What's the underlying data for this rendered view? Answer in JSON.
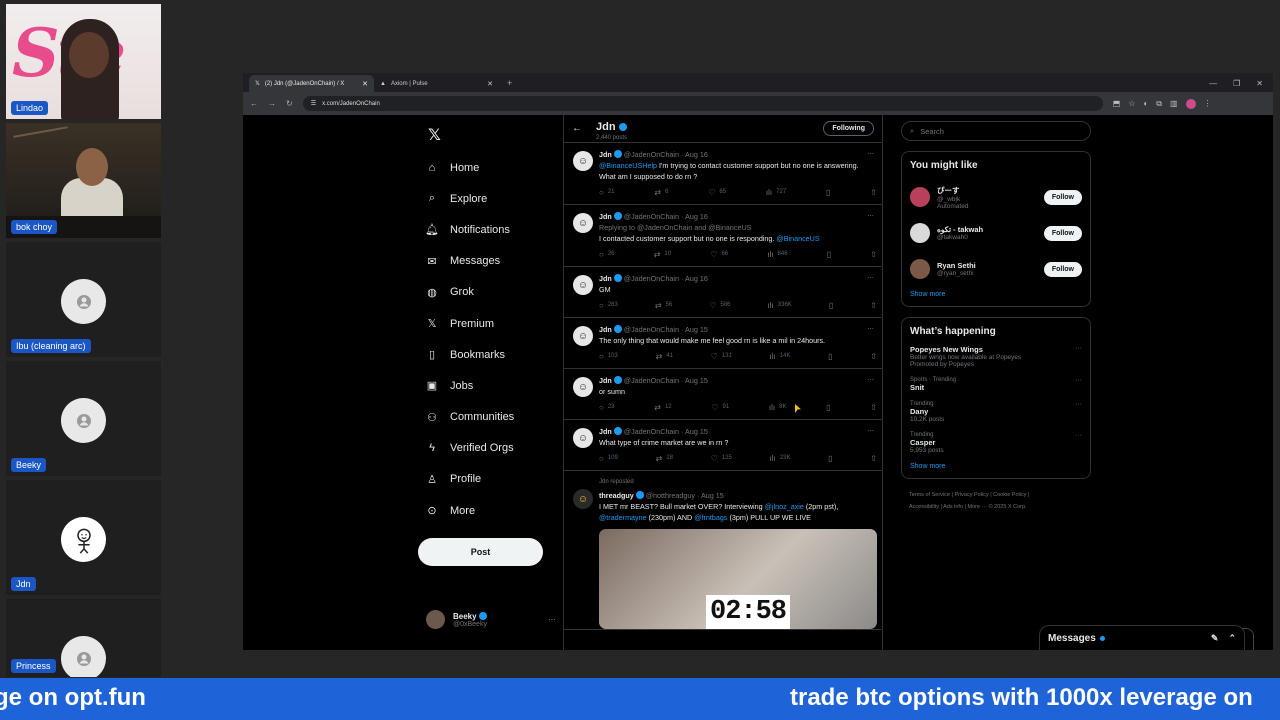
{
  "participants": [
    {
      "name": "Lindao",
      "video": true
    },
    {
      "name": "bok choy",
      "video": true
    },
    {
      "name": "Ibu (cleaning arc)",
      "video": false
    },
    {
      "name": "Beeky",
      "video": false
    },
    {
      "name": "Jdn",
      "video": false
    },
    {
      "name": "Princess",
      "video": false
    }
  ],
  "video_overlay_text": "Ste",
  "browser": {
    "tabs": [
      {
        "title": "(2) Jdn (@JadenOnChain) / X",
        "icon": "x-icon"
      },
      {
        "title": "Axiom | Pulse",
        "icon": "axiom-icon"
      }
    ],
    "url": "x.com/JadenOnChain"
  },
  "nav": {
    "items": [
      {
        "label": "Home",
        "icon": "home-icon"
      },
      {
        "label": "Explore",
        "icon": "search-icon"
      },
      {
        "label": "Notifications",
        "icon": "bell-icon"
      },
      {
        "label": "Messages",
        "icon": "mail-icon"
      },
      {
        "label": "Grok",
        "icon": "grok-icon"
      },
      {
        "label": "Premium",
        "icon": "x-icon"
      },
      {
        "label": "Bookmarks",
        "icon": "bookmark-icon"
      },
      {
        "label": "Jobs",
        "icon": "briefcase-icon"
      },
      {
        "label": "Communities",
        "icon": "people-icon"
      },
      {
        "label": "Verified Orgs",
        "icon": "lightning-icon"
      },
      {
        "label": "Profile",
        "icon": "person-icon"
      },
      {
        "label": "More",
        "icon": "more-circle-icon"
      }
    ],
    "post_label": "Post",
    "account": {
      "name": "Beeky",
      "handle": "@0xBeeky"
    }
  },
  "profile_header": {
    "name": "Jdn",
    "posts": "2,440 posts",
    "following_label": "Following"
  },
  "tweets": [
    {
      "name": "Jdn",
      "handle": "@JadenOnChain",
      "date": "Aug 16",
      "reply_to": "",
      "mention": "@BinanceUSHelp",
      "text": "I'm trying to contact customer support but no one is answering. What am I supposed to do rn ?",
      "tail": "",
      "replies": "21",
      "reposts": "6",
      "likes": "65",
      "views": "727"
    },
    {
      "name": "Jdn",
      "handle": "@JadenOnChain",
      "date": "Aug 16",
      "reply_to": "Replying to @JadenOnChain and @BinanceUS",
      "mention": "",
      "text": "I contacted customer support but no one is responding.",
      "tail": "@BinanceUS",
      "replies": "26",
      "reposts": "10",
      "likes": "66",
      "views": "846"
    },
    {
      "name": "Jdn",
      "handle": "@JadenOnChain",
      "date": "Aug 16",
      "reply_to": "",
      "mention": "",
      "text": "GM",
      "tail": "",
      "replies": "263",
      "reposts": "56",
      "likes": "586",
      "views": "336K"
    },
    {
      "name": "Jdn",
      "handle": "@JadenOnChain",
      "date": "Aug 15",
      "reply_to": "",
      "mention": "",
      "text": "The only thing that would make me feel good rn is like a mil in 24hours.",
      "tail": "",
      "replies": "103",
      "reposts": "41",
      "likes": "131",
      "views": "14K"
    },
    {
      "name": "Jdn",
      "handle": "@JadenOnChain",
      "date": "Aug 15",
      "reply_to": "",
      "mention": "",
      "text": "or sumn",
      "tail": "",
      "replies": "23",
      "reposts": "12",
      "likes": "91",
      "views": "8K"
    },
    {
      "name": "Jdn",
      "handle": "@JadenOnChain",
      "date": "Aug 15",
      "reply_to": "",
      "mention": "",
      "text": "What type of crime market are we in rn ?",
      "tail": "",
      "replies": "109",
      "reposts": "28",
      "likes": "125",
      "views": "23K"
    }
  ],
  "repost": {
    "label": "Jdn reposted",
    "name": "threadguy",
    "handle": "@notthreadguy",
    "date": "Aug 15",
    "text1": "I MET mr BEAST? Bull market OVER? Interviewing",
    "mention1": "@jlnoz_axie",
    "text2": "(2pm pst),",
    "mention2": "@tradermayne",
    "text3": "(230pm) AND",
    "mention3": "@frntbags",
    "text4": "(3pm) PULL UP WE LIVE",
    "video_time": "02:58"
  },
  "sidebar": {
    "search_placeholder": "Search",
    "you_might_like": "You might like",
    "who": [
      {
        "name": "ぴーす",
        "handle": "@_wbjk",
        "note": "Automated",
        "follow": "Follow",
        "color": "#b8405a"
      },
      {
        "name": "تکوه - takwah",
        "handle": "@takwah0",
        "note": "",
        "follow": "Follow",
        "color": "#d9d9d9"
      },
      {
        "name": "Ryan Sethi",
        "handle": "@ryan_sethi",
        "note": "",
        "follow": "Follow",
        "color": "#7a5a46"
      }
    ],
    "show_more": "Show more",
    "whats_happening": "What’s happening",
    "trends": [
      {
        "category": "",
        "name": "Popeyes New Wings",
        "desc": "Better wings now available at Popeyes",
        "extra": "Promoted by Popeyes"
      },
      {
        "category": "Sports · Trending",
        "name": "Snit",
        "desc": "",
        "extra": ""
      },
      {
        "category": "Trending",
        "name": "Dany",
        "desc": "10.2K posts",
        "extra": ""
      },
      {
        "category": "Trending",
        "name": "Casper",
        "desc": "5,953 posts",
        "extra": ""
      }
    ],
    "show_more2": "Show more",
    "footer1": "Terms of Service  |  Privacy Policy  |  Cookie Policy  |",
    "footer2": "Accessibility  |  Ads info  |  More ···  © 2025 X Corp."
  },
  "messages_bar": {
    "label": "Messages"
  },
  "ticker": {
    "left": "ge on opt.fun",
    "right": "trade btc options with 1000x leverage on"
  }
}
